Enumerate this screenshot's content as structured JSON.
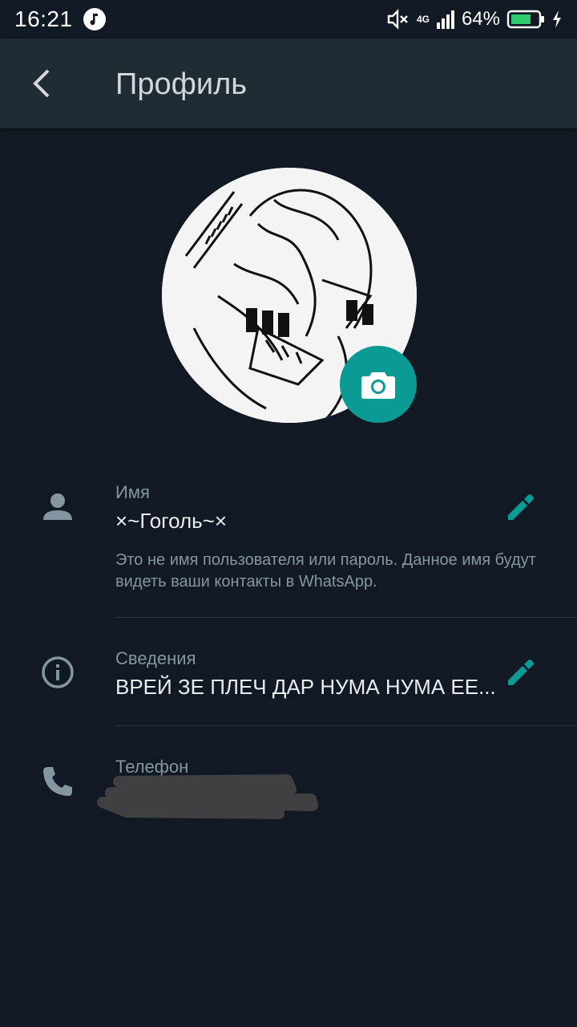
{
  "status_bar": {
    "time": "16:21",
    "network": "4G",
    "battery": "64%",
    "icons": [
      "music-icon",
      "mute-icon",
      "signal-icon",
      "battery-icon",
      "charging-icon"
    ]
  },
  "app_bar": {
    "title": "Профиль",
    "back_icon": "chevron-left-icon"
  },
  "profile": {
    "camera_icon": "camera-icon",
    "name": {
      "label": "Имя",
      "value": "×~Гоголь~×",
      "hint": "Это не имя пользователя или пароль. Данное имя будут видеть ваши контакты в WhatsApp."
    },
    "about": {
      "label": "Сведения",
      "value": "ВРЕЙ ЗЕ ПЛЕЧ ДАР НУМА НУМА ЕЕ..."
    },
    "phone": {
      "label": "Телефон"
    }
  },
  "colors": {
    "background": "#111a24",
    "app_bar": "#1f2c34",
    "accent": "#0c9a94",
    "secondary_text": "#8696a0"
  }
}
